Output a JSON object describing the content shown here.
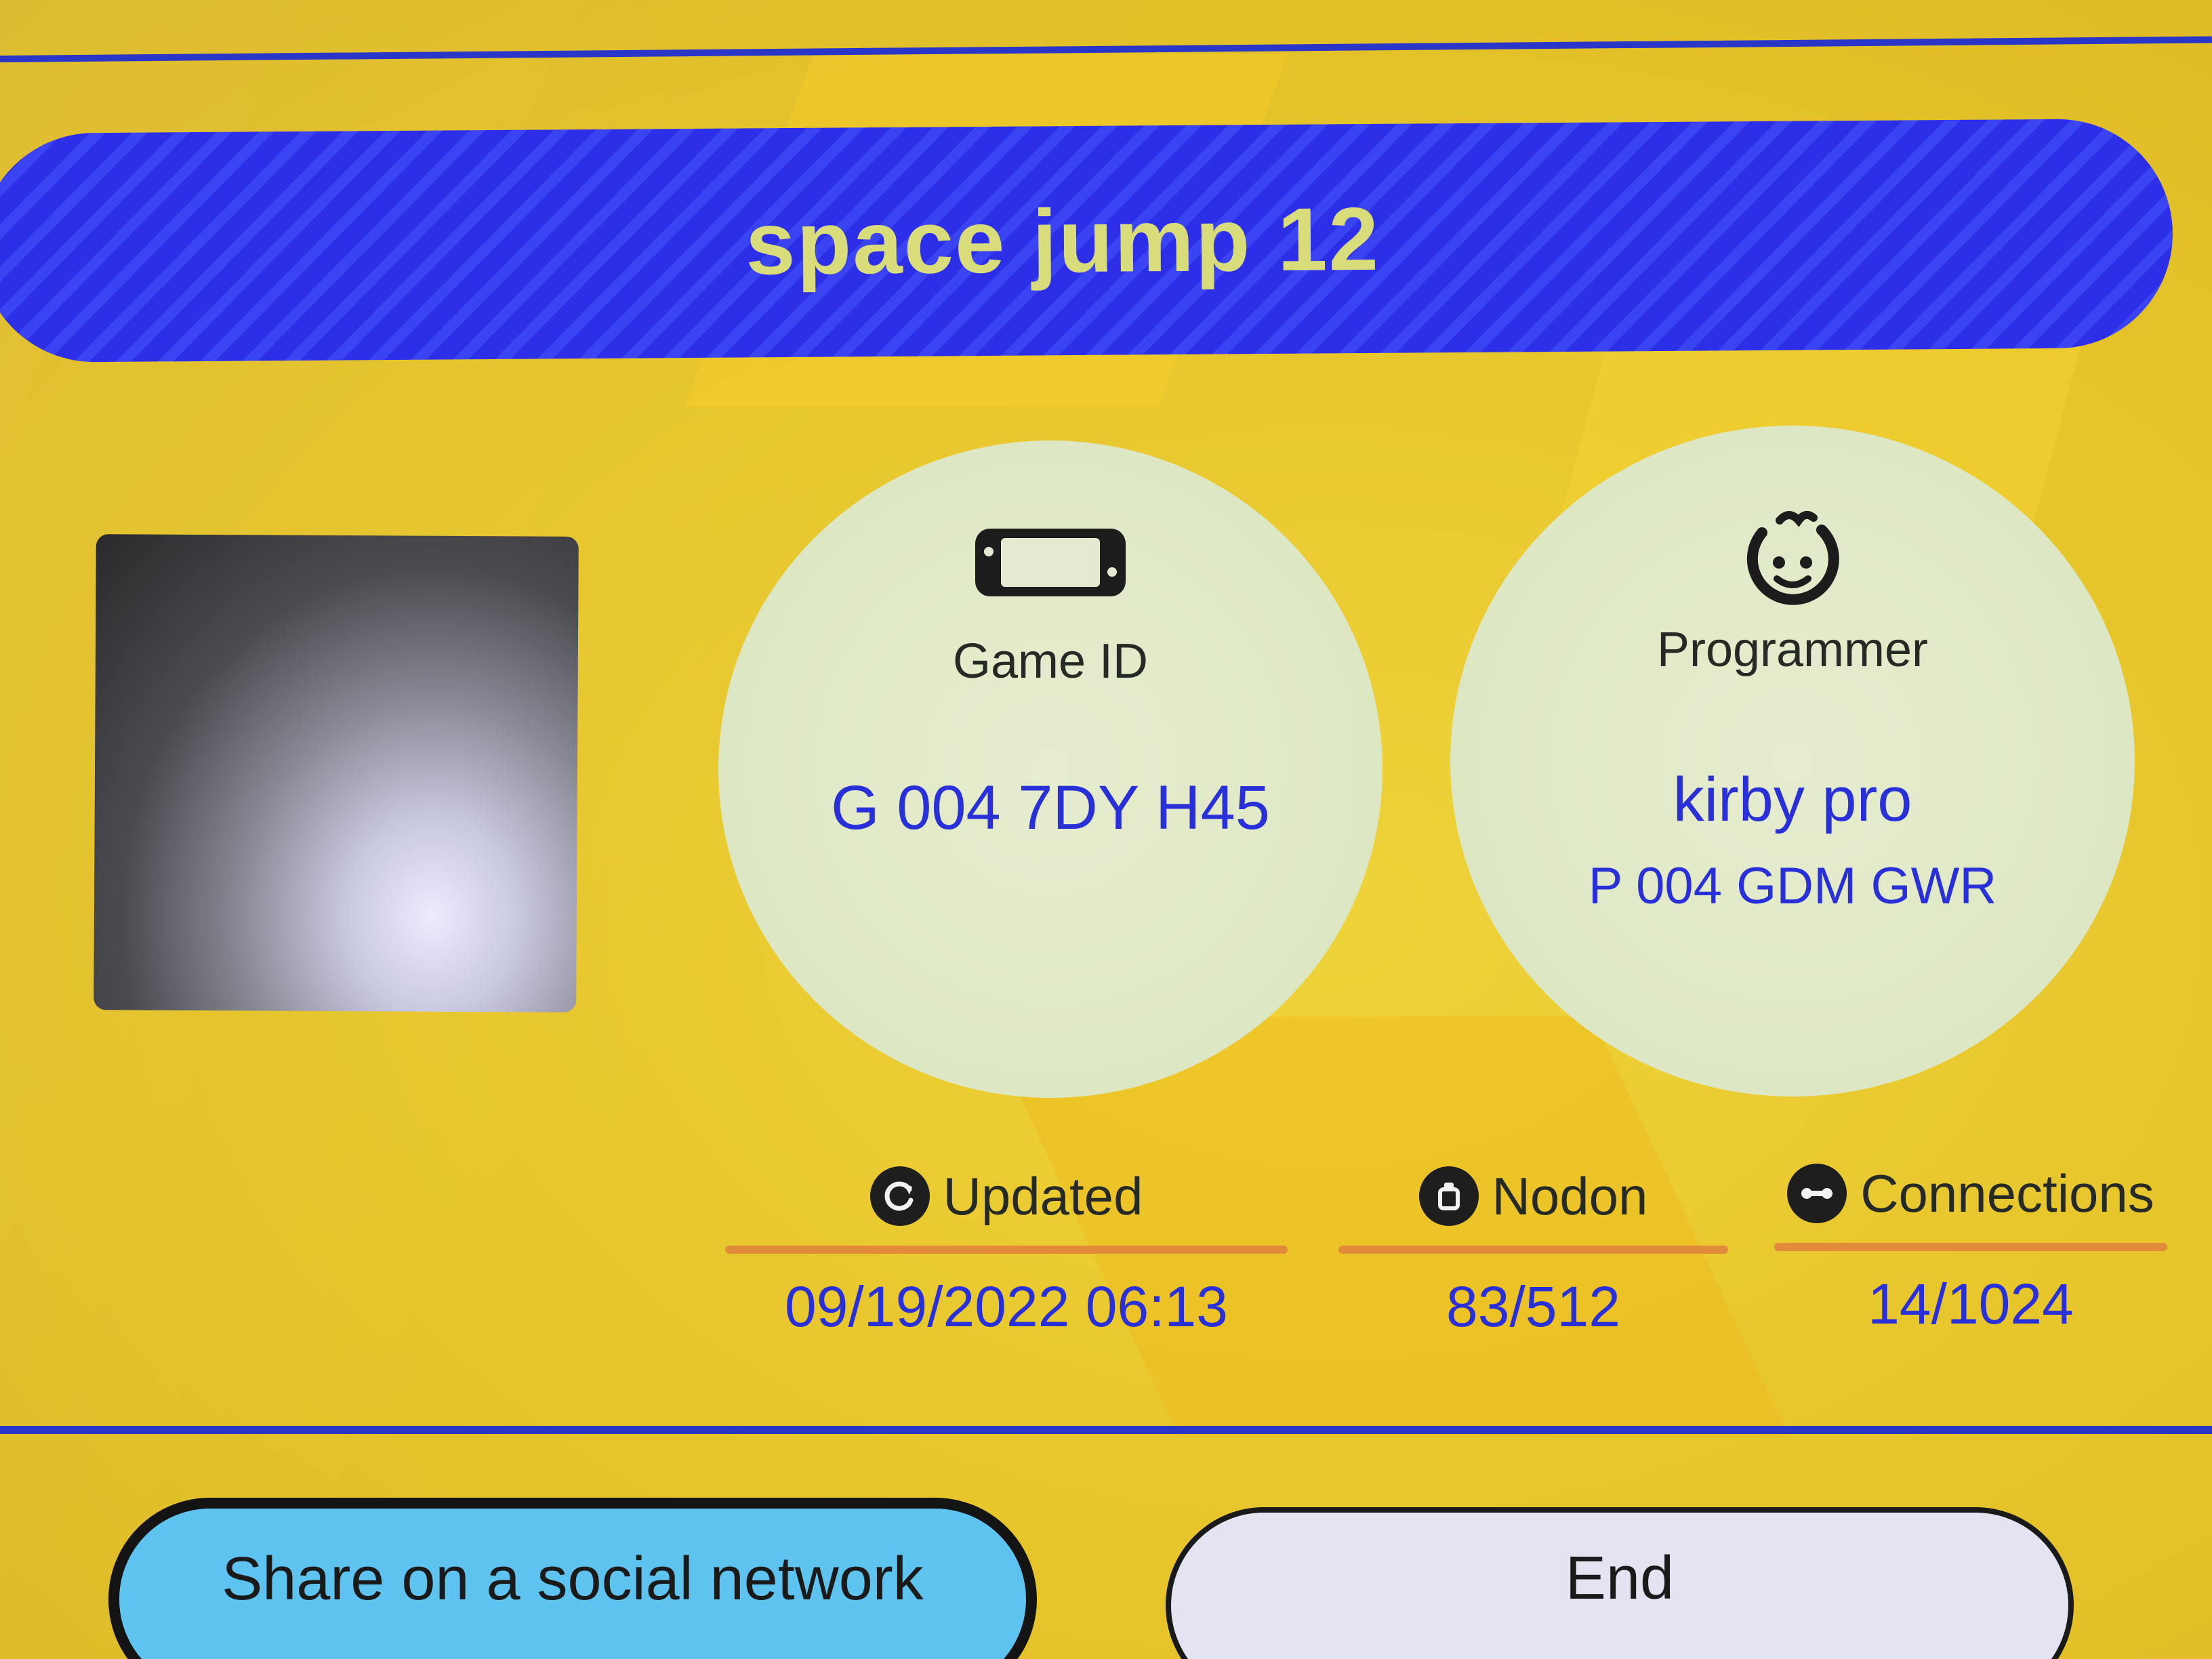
{
  "title": "space jump 12",
  "game_id": {
    "icon": "console-icon",
    "label": "Game ID",
    "value": "G 004 7DY H45"
  },
  "programmer": {
    "icon": "smiley-face-icon",
    "label": "Programmer",
    "name": "kirby pro",
    "id": "P 004 GDM GWR"
  },
  "stats": {
    "updated": {
      "icon": "refresh-icon",
      "label": "Updated",
      "value": "09/19/2022 06:13"
    },
    "nodon": {
      "icon": "nodon-icon",
      "label": "Nodon",
      "value": "83/512"
    },
    "connections": {
      "icon": "connection-icon",
      "label": "Connections",
      "value": "14/1024"
    }
  },
  "buttons": {
    "share": "Share on a social network",
    "end": "End"
  },
  "colors": {
    "background": "#e9c82e",
    "title_bar": "#2c2ee8",
    "title_text": "#d9dc7a",
    "value_text": "#2a30d8",
    "rule": "#e08a3a",
    "share_button": "#5ec3ee",
    "end_button": "#e4e3f2"
  }
}
